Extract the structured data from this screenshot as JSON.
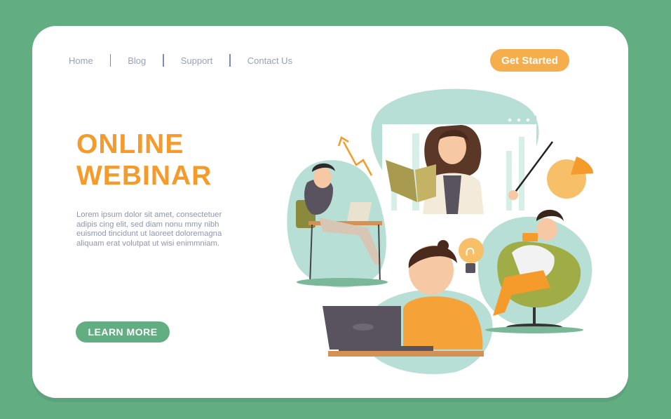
{
  "nav": {
    "items": [
      "Home",
      "Blog",
      "Support",
      "Contact Us"
    ],
    "cta_label": "Get Started"
  },
  "hero": {
    "title_line1": "ONLINE",
    "title_line2": "WEBINAR",
    "body_lines": [
      "Lorem ipsum dolor sit amet, consectetuer",
      "adipis cing elit, sed diam nonu mmy nibh",
      "euismod tincidunt ut laoreet doloremagna",
      "aliquam erat volutpat ut wisi enimmniam."
    ],
    "learn_more_label": "LEARN MORE"
  },
  "colors": {
    "background": "#62ad82",
    "accent_orange": "#f49b2c",
    "button_orange": "#f6ad4c",
    "button_green": "#62ad82",
    "blob": "#b8dfd5",
    "nav_text": "#9aa0b8"
  },
  "illustration": {
    "icons": [
      "presenter",
      "teacher-with-book",
      "man-with-laptop",
      "woman-with-laptop",
      "boy-on-chair",
      "lightbulb-icon",
      "pie-chart-icon",
      "growth-arrow-icon"
    ]
  }
}
